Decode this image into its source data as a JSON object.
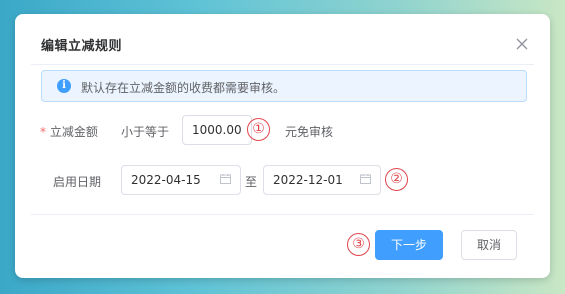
{
  "dialog": {
    "title": "编辑立减规则",
    "alert_text": "默认存在立减金额的收费都需要审核。",
    "amount": {
      "label": "立减金额",
      "required_mark": "*",
      "prefix": "小于等于",
      "value": "1000.00",
      "suffix": "元免审核"
    },
    "dates": {
      "label": "启用日期",
      "start": "2022-04-15",
      "separator": "至",
      "end": "2022-12-01"
    },
    "markers": [
      "①",
      "②",
      "③"
    ],
    "buttons": {
      "next": "下一步",
      "cancel": "取消"
    }
  },
  "colors": {
    "primary": "#409eff",
    "alert_bg": "#ecf5ff",
    "required": "#f56c6c",
    "marker": "#e0464c"
  },
  "icons": [
    "close-icon",
    "info-icon",
    "calendar-icon"
  ]
}
